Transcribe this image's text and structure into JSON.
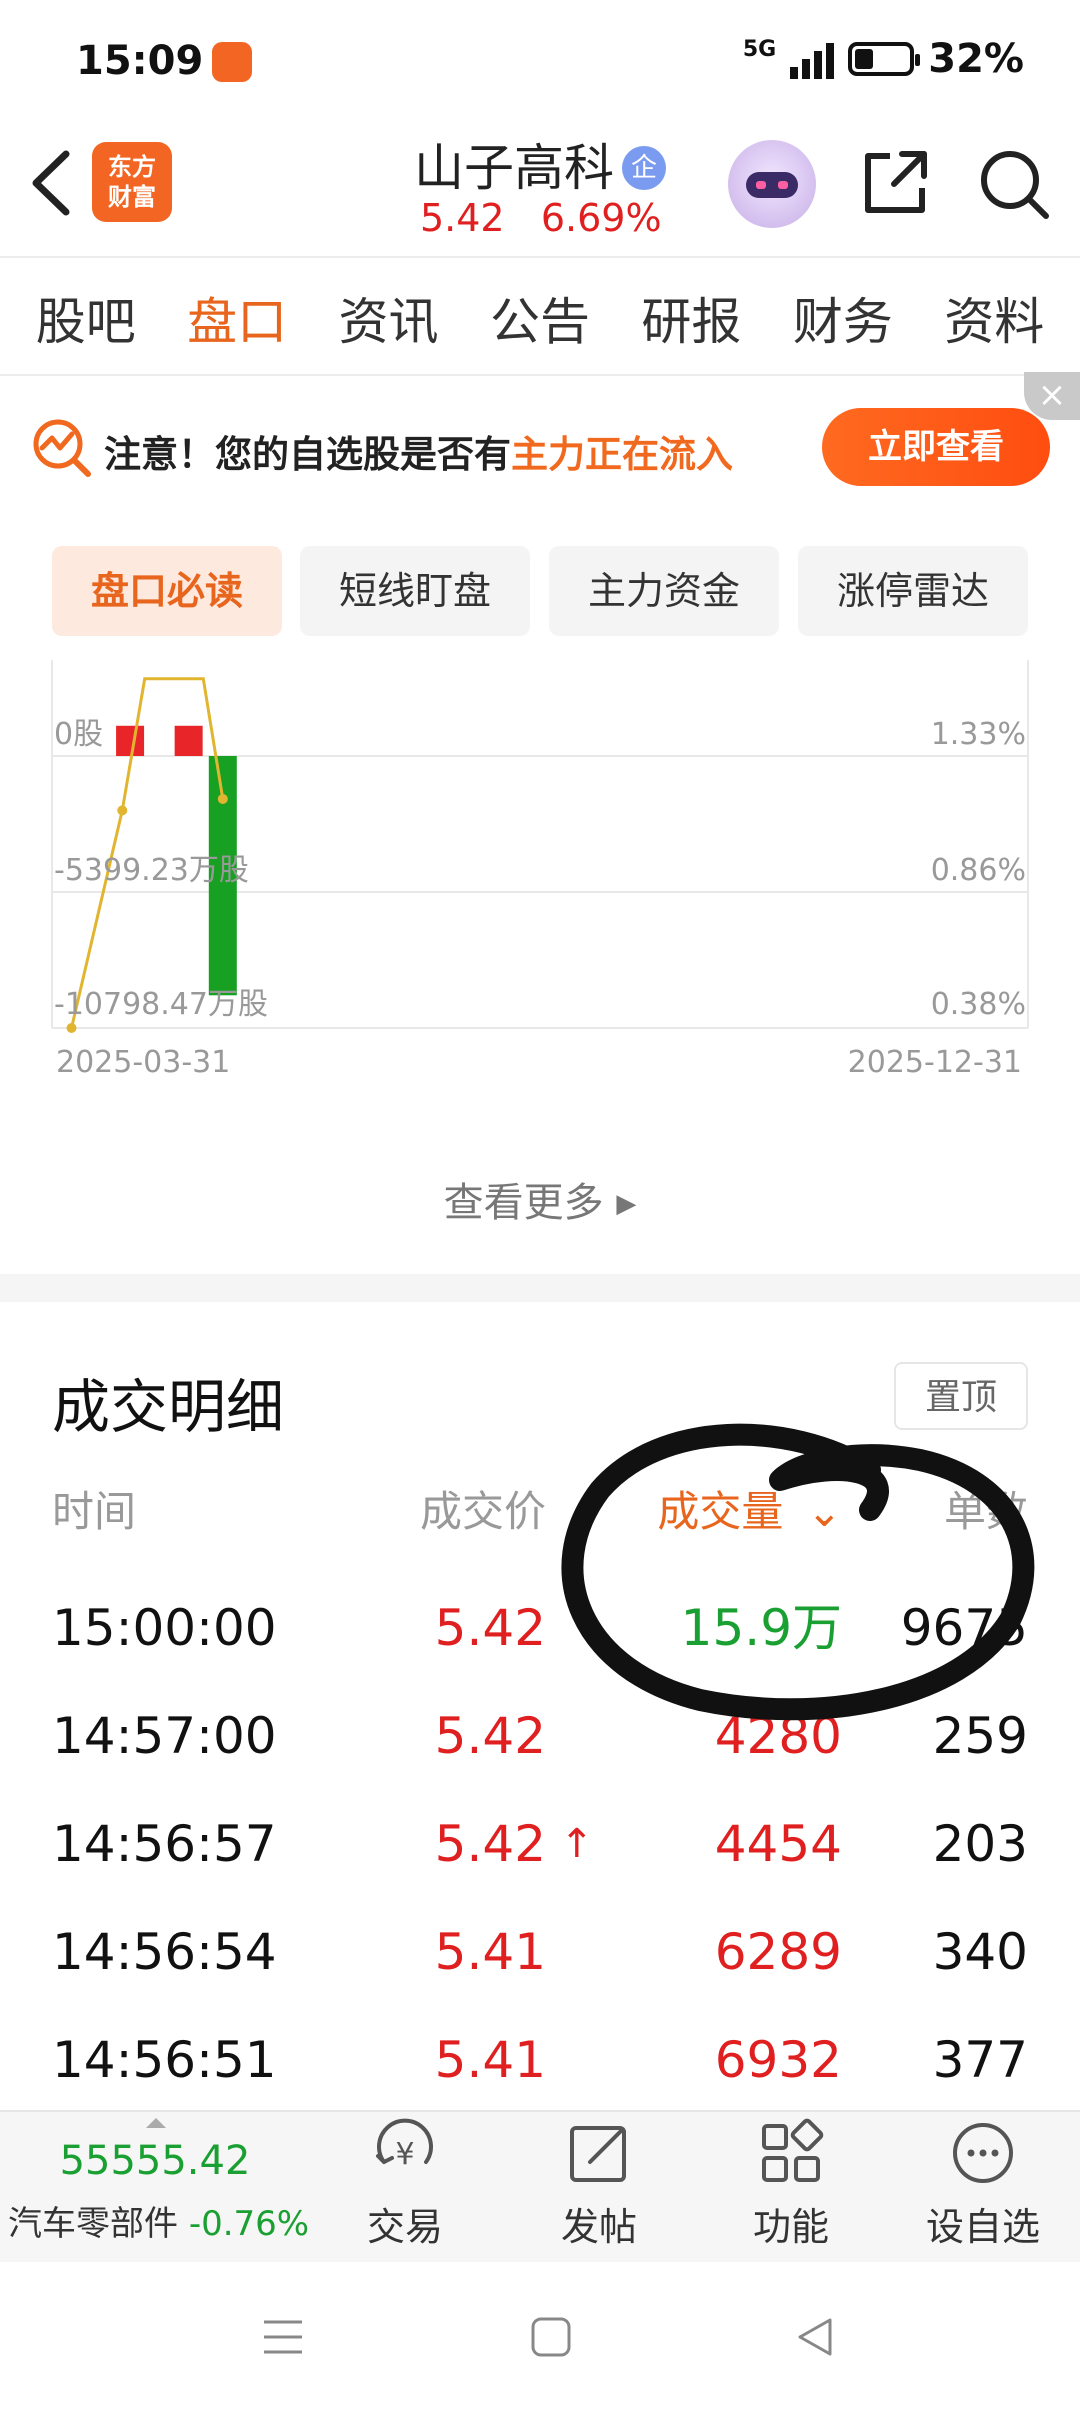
{
  "status_bar": {
    "time": "15:09",
    "network": "5G",
    "battery": "32%"
  },
  "header": {
    "logo_line1": "东方",
    "logo_line2": "财富",
    "stock_name": "山子高科",
    "badge": "企",
    "price": "5.42",
    "change_pct": "6.69%"
  },
  "tabs": [
    {
      "label": "股吧"
    },
    {
      "label": "盘口"
    },
    {
      "label": "资讯"
    },
    {
      "label": "公告"
    },
    {
      "label": "研报"
    },
    {
      "label": "财务"
    },
    {
      "label": "资料"
    }
  ],
  "notice": {
    "prefix": "注意！您的自选股是否有",
    "highlight": "主力正在流入",
    "button": "立即查看",
    "close": "×"
  },
  "subtabs": [
    {
      "label": "盘口必读"
    },
    {
      "label": "短线盯盘"
    },
    {
      "label": "主力资金"
    },
    {
      "label": "涨停雷达"
    }
  ],
  "chart_data": {
    "type": "bar",
    "left_axis_labels": [
      "0股",
      "-5399.23万股",
      "-10798.47万股"
    ],
    "right_axis_labels": [
      "1.33%",
      "0.86%",
      "0.38%"
    ],
    "x_start": "2025-03-31",
    "x_end": "2025-12-31",
    "colors": {
      "up": "#e8262a",
      "down": "#17a021",
      "line": "#e2b531",
      "grid": "#e8e8e8"
    },
    "ylim_left": [
      -10798.47,
      0
    ],
    "ylim_right": [
      0.38,
      1.33
    ],
    "bars": [
      {
        "position": 0.08,
        "value": 1200,
        "color": "up"
      },
      {
        "position": 0.14,
        "value": 1200,
        "color": "up"
      },
      {
        "position": 0.175,
        "value": -9500,
        "color": "down"
      }
    ],
    "line_points": [
      {
        "position": 0.02,
        "value": 0.38
      },
      {
        "position": 0.072,
        "value": 1.14
      },
      {
        "position": 0.095,
        "value": 1.6
      },
      {
        "position": 0.155,
        "value": 1.6
      },
      {
        "position": 0.175,
        "value": 1.18
      }
    ]
  },
  "more_link": "查看更多",
  "trade_details": {
    "title": "成交明细",
    "pin_label": "置顶",
    "columns": {
      "time": "时间",
      "price": "成交价",
      "volume": "成交量",
      "count": "单数"
    },
    "rows": [
      {
        "time": "15:00:00",
        "price": "5.42",
        "up": "",
        "volume": "15.9万",
        "volume_color": "#1aa032",
        "count": "9675"
      },
      {
        "time": "14:57:00",
        "price": "5.42",
        "up": "",
        "volume": "4280",
        "volume_color": "#e02020",
        "count": "259"
      },
      {
        "time": "14:56:57",
        "price": "5.42",
        "up": "↑",
        "volume": "4454",
        "volume_color": "#e02020",
        "count": "203"
      },
      {
        "time": "14:56:54",
        "price": "5.41",
        "up": "",
        "volume": "6289",
        "volume_color": "#e02020",
        "count": "340"
      },
      {
        "time": "14:56:51",
        "price": "5.41",
        "up": "",
        "volume": "6932",
        "volume_color": "#e02020",
        "count": "377"
      }
    ]
  },
  "bottom_bar": {
    "index_value": "55555.42",
    "index_name": "汽车零部件",
    "index_change": "-0.76%",
    "buttons": [
      {
        "label": "交易"
      },
      {
        "label": "发帖"
      },
      {
        "label": "功能"
      },
      {
        "label": "设自选"
      }
    ]
  }
}
